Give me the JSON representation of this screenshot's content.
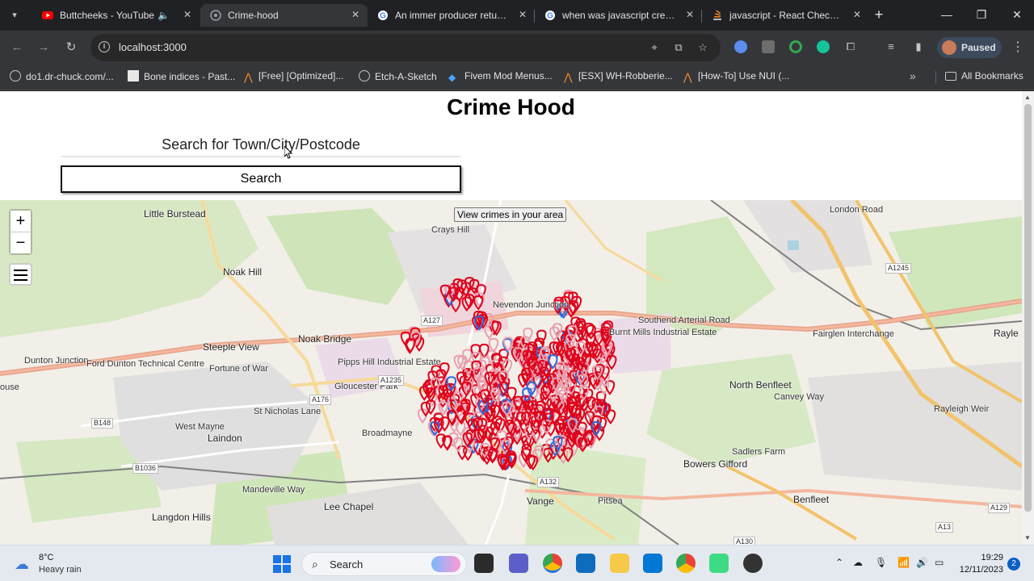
{
  "browser": {
    "tabs": [
      {
        "title": "Buttcheeks - YouTube",
        "active": false,
        "favicon": "youtube-icon",
        "color": "#ff0000"
      },
      {
        "title": "Crime-hood",
        "active": true,
        "favicon": "react-app-icon",
        "color": "#9aa0a6"
      },
      {
        "title": "An immer producer returned a",
        "active": false,
        "favicon": "google-icon",
        "color": "#4285f4"
      },
      {
        "title": "when was javascript created",
        "active": false,
        "favicon": "google-icon",
        "color": "#4285f4"
      },
      {
        "title": "javascript - React Checkbox",
        "active": false,
        "favicon": "stackoverflow-icon",
        "color": "#f48024"
      }
    ],
    "url": "localhost:3000",
    "profile_label": "Paused",
    "bookmarks": [
      {
        "label": "do1.dr-chuck.com/...",
        "icon": "globe-icon"
      },
      {
        "label": "Bone indices - Past...",
        "icon": "page-icon"
      },
      {
        "label": "[Free] [Optimized]...",
        "icon": "cfx-icon"
      },
      {
        "label": "Etch-A-Sketch",
        "icon": "globe-icon"
      },
      {
        "label": "Fivem Mod Menus...",
        "icon": "gem-icon"
      },
      {
        "label": "[ESX] WH-Robberie...",
        "icon": "cfx-icon"
      },
      {
        "label": "[How-To] Use NUI (...",
        "icon": "cfx-icon"
      }
    ],
    "all_bookmarks_label": "All Bookmarks"
  },
  "app": {
    "title": "Crime Hood",
    "search_placeholder": "Search for Town/City/Postcode",
    "search_button": "Search",
    "view_crimes_button": "View crimes in your area",
    "zoom_in": "+",
    "zoom_out": "−"
  },
  "map": {
    "places": [
      {
        "name": "Little Burstead"
      },
      {
        "name": "Crays Hill"
      },
      {
        "name": "Noak Hill"
      },
      {
        "name": "Noak Bridge"
      },
      {
        "name": "Steeple View"
      },
      {
        "name": "Dunton Junction"
      },
      {
        "name": "Ford Dunton Technical Centre"
      },
      {
        "name": "Fortune of War"
      },
      {
        "name": "Pipps Hill Industrial Estate"
      },
      {
        "name": "Gloucester Park"
      },
      {
        "name": "St Nicholas Lane"
      },
      {
        "name": "West Mayne"
      },
      {
        "name": "Laindon"
      },
      {
        "name": "Mandeville Way"
      },
      {
        "name": "Langdon Hills"
      },
      {
        "name": "Lee Chapel"
      },
      {
        "name": "Vange"
      },
      {
        "name": "Nevendon Junction"
      },
      {
        "name": "Burnt Mills Industrial Estate"
      },
      {
        "name": "Southend Arterial Road"
      },
      {
        "name": "North Benfleet"
      },
      {
        "name": "Bowers Gifford"
      },
      {
        "name": "Sadlers Farm"
      },
      {
        "name": "Benfleet"
      },
      {
        "name": "Fairglen Interchange"
      },
      {
        "name": "Rayleigh Weir"
      },
      {
        "name": "Rayle"
      },
      {
        "name": "London Road"
      },
      {
        "name": "Pitsea"
      },
      {
        "name": "Broadmayne"
      },
      {
        "name": "Canvey Way"
      },
      {
        "name": "ouse"
      }
    ],
    "roads": [
      "A127",
      "A1235",
      "A176",
      "B148",
      "B1036",
      "A132",
      "A1245",
      "A129",
      "A13",
      "A130"
    ]
  },
  "taskbar": {
    "weather_temp": "8°C",
    "weather_desc": "Heavy rain",
    "search_label": "Search",
    "time": "19:29",
    "date": "12/11/2023",
    "notifications": "2"
  }
}
